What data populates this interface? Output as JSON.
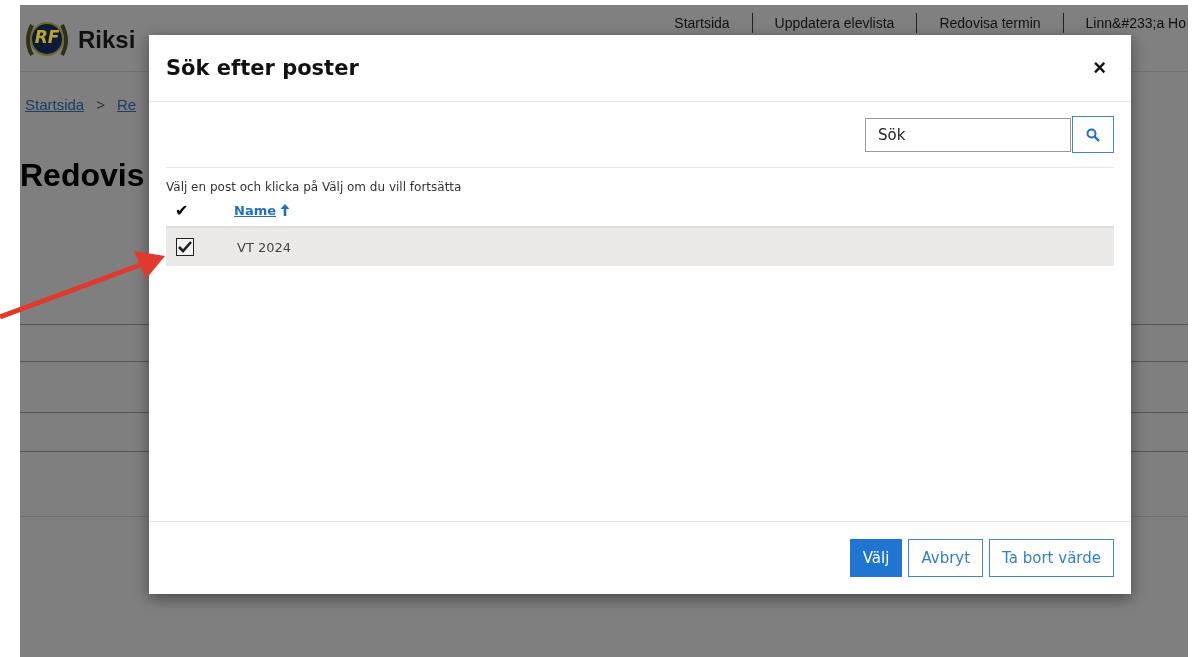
{
  "background_page": {
    "logo_text": "RF",
    "site_title": "Riksi",
    "nav": [
      "Startsida",
      "Uppdatera elevlista",
      "Redovisa termin",
      "Linn&#233;a Ho"
    ],
    "breadcrumb": [
      "Startsida",
      ">",
      "Re"
    ],
    "heading": "Redovis"
  },
  "dialog": {
    "title": "Sök efter poster",
    "close": "×",
    "search": {
      "placeholder": "Sök"
    },
    "instruction": "Välj en post och klicka på Välj om du vill fortsätta",
    "table": {
      "select_column": "✔",
      "columns": [
        {
          "label": "Name",
          "sorted_ascending": true
        }
      ],
      "rows": [
        {
          "selected": true,
          "name": "VT 2024"
        }
      ]
    },
    "buttons": [
      {
        "label": "Välj",
        "kind": "primary"
      },
      {
        "label": "Avbryt",
        "kind": "secondary"
      },
      {
        "label": "Ta bort värde",
        "kind": "secondary"
      }
    ]
  }
}
